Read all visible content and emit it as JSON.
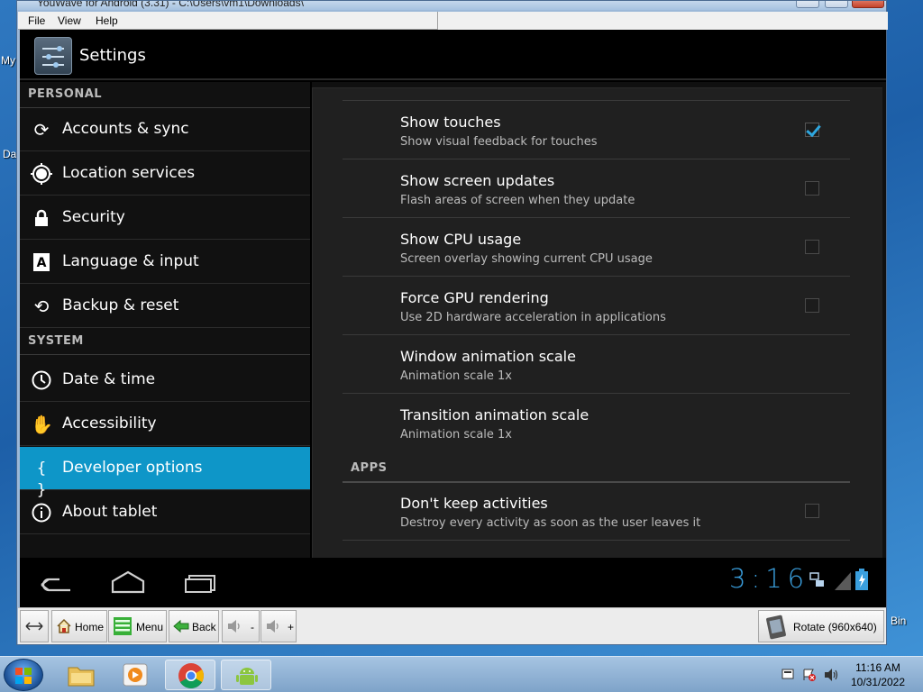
{
  "window": {
    "title": "YouWave for Android (3.31) - C:\\Users\\vm1\\Downloads\\",
    "menu": [
      "File",
      "View",
      "Help"
    ]
  },
  "android": {
    "app_title": "Settings",
    "left_pane": {
      "personal_header": "PERSONAL",
      "system_header": "SYSTEM",
      "items": [
        {
          "label": "Accounts & sync",
          "icon": "sync-icon"
        },
        {
          "label": "Location services",
          "icon": "location-icon"
        },
        {
          "label": "Security",
          "icon": "lock-icon"
        },
        {
          "label": "Language & input",
          "icon": "language-icon"
        },
        {
          "label": "Backup & reset",
          "icon": "backup-icon"
        },
        {
          "label": "Date & time",
          "icon": "clock-icon"
        },
        {
          "label": "Accessibility",
          "icon": "hand-icon"
        },
        {
          "label": "Developer options",
          "icon": "braces-icon",
          "selected": true
        },
        {
          "label": "About tablet",
          "icon": "info-icon"
        }
      ]
    },
    "right_pane": {
      "prefs": [
        {
          "title": "Show touches",
          "summary": "Show visual feedback for touches",
          "checked": true
        },
        {
          "title": "Show screen updates",
          "summary": "Flash areas of screen when they update",
          "checked": false
        },
        {
          "title": "Show CPU usage",
          "summary": "Screen overlay showing current CPU usage",
          "checked": false
        },
        {
          "title": "Force GPU rendering",
          "summary": "Use 2D hardware acceleration in applications",
          "checked": false
        },
        {
          "title": "Window animation scale",
          "summary": "Animation scale 1x"
        },
        {
          "title": "Transition animation scale",
          "summary": "Animation scale 1x"
        }
      ],
      "apps_header": "APPS",
      "app_prefs": [
        {
          "title": "Don't keep activities",
          "summary": "Destroy every activity as soon as the user leaves it",
          "checked": false
        }
      ]
    },
    "status": {
      "clock": "3:16"
    },
    "accent": "#33b5e5"
  },
  "toolbar": {
    "home": "Home",
    "menu": "Menu",
    "back": "Back",
    "vol_down": "-",
    "vol_up": "+",
    "rotate": "Rotate (960x640)"
  },
  "taskbar": {
    "time": "11:16 AM",
    "date": "10/31/2022"
  },
  "desktop": {
    "frag_my": "My",
    "frag_da": "Da",
    "frag_bin": "Bin"
  }
}
